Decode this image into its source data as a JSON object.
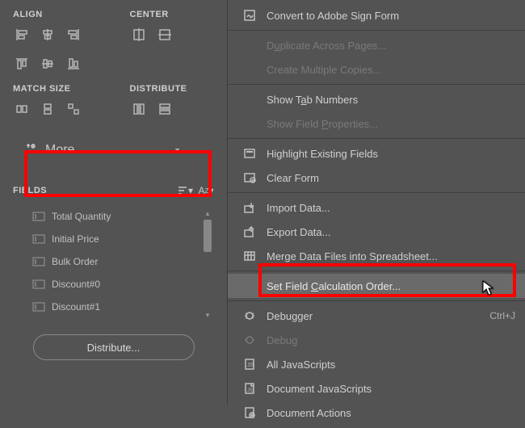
{
  "left": {
    "align_label": "ALIGN",
    "center_label": "CENTER",
    "match_size_label": "MATCH SIZE",
    "distribute_label": "DISTRIBUTE",
    "more_label": "More",
    "fields_label": "FIELDS",
    "fields": [
      {
        "label": "Total Quantity"
      },
      {
        "label": "Initial Price"
      },
      {
        "label": "Bulk Order"
      },
      {
        "label": "Discount#0"
      },
      {
        "label": "Discount#1"
      }
    ],
    "distribute_btn": "Distribute..."
  },
  "menu": {
    "items": [
      {
        "label": "Convert to Adobe Sign Form",
        "icon": "sign-icon",
        "disabled": false
      },
      {
        "sep": true
      },
      {
        "label": "Duplicate Across Pages...",
        "underlineIdx": 1,
        "disabled": true,
        "noicon": true
      },
      {
        "label": "Create Multiple Copies...",
        "disabled": true,
        "noicon": true
      },
      {
        "sep": true
      },
      {
        "label": "Show Tab Numbers",
        "underlineIdx": 6,
        "disabled": false,
        "noicon": true
      },
      {
        "label": "Show Field Properties...",
        "underlineIdx": 11,
        "disabled": true,
        "noicon": true
      },
      {
        "sep": true
      },
      {
        "label": "Highlight Existing Fields",
        "icon": "highlight-fields-icon"
      },
      {
        "label": "Clear Form",
        "icon": "clear-form-icon"
      },
      {
        "sep": true
      },
      {
        "label": "Import Data...",
        "icon": "import-data-icon"
      },
      {
        "label": "Export Data...",
        "icon": "export-data-icon"
      },
      {
        "label": "Merge Data Files into Spreadsheet...",
        "icon": "merge-data-icon"
      },
      {
        "sep": true
      },
      {
        "label": "Set Field Calculation Order...",
        "underlineIdx": 10,
        "highlighted": true,
        "noicon": true
      },
      {
        "sep": true
      },
      {
        "label": "Debugger",
        "icon": "debugger-icon",
        "kbd": "Ctrl+J"
      },
      {
        "label": "Debug",
        "icon": "debug-icon",
        "disabled": true
      },
      {
        "label": "All JavaScripts",
        "icon": "all-js-icon"
      },
      {
        "label": "Document JavaScripts",
        "icon": "doc-js-icon"
      },
      {
        "label": "Document Actions",
        "icon": "doc-actions-icon"
      }
    ]
  }
}
